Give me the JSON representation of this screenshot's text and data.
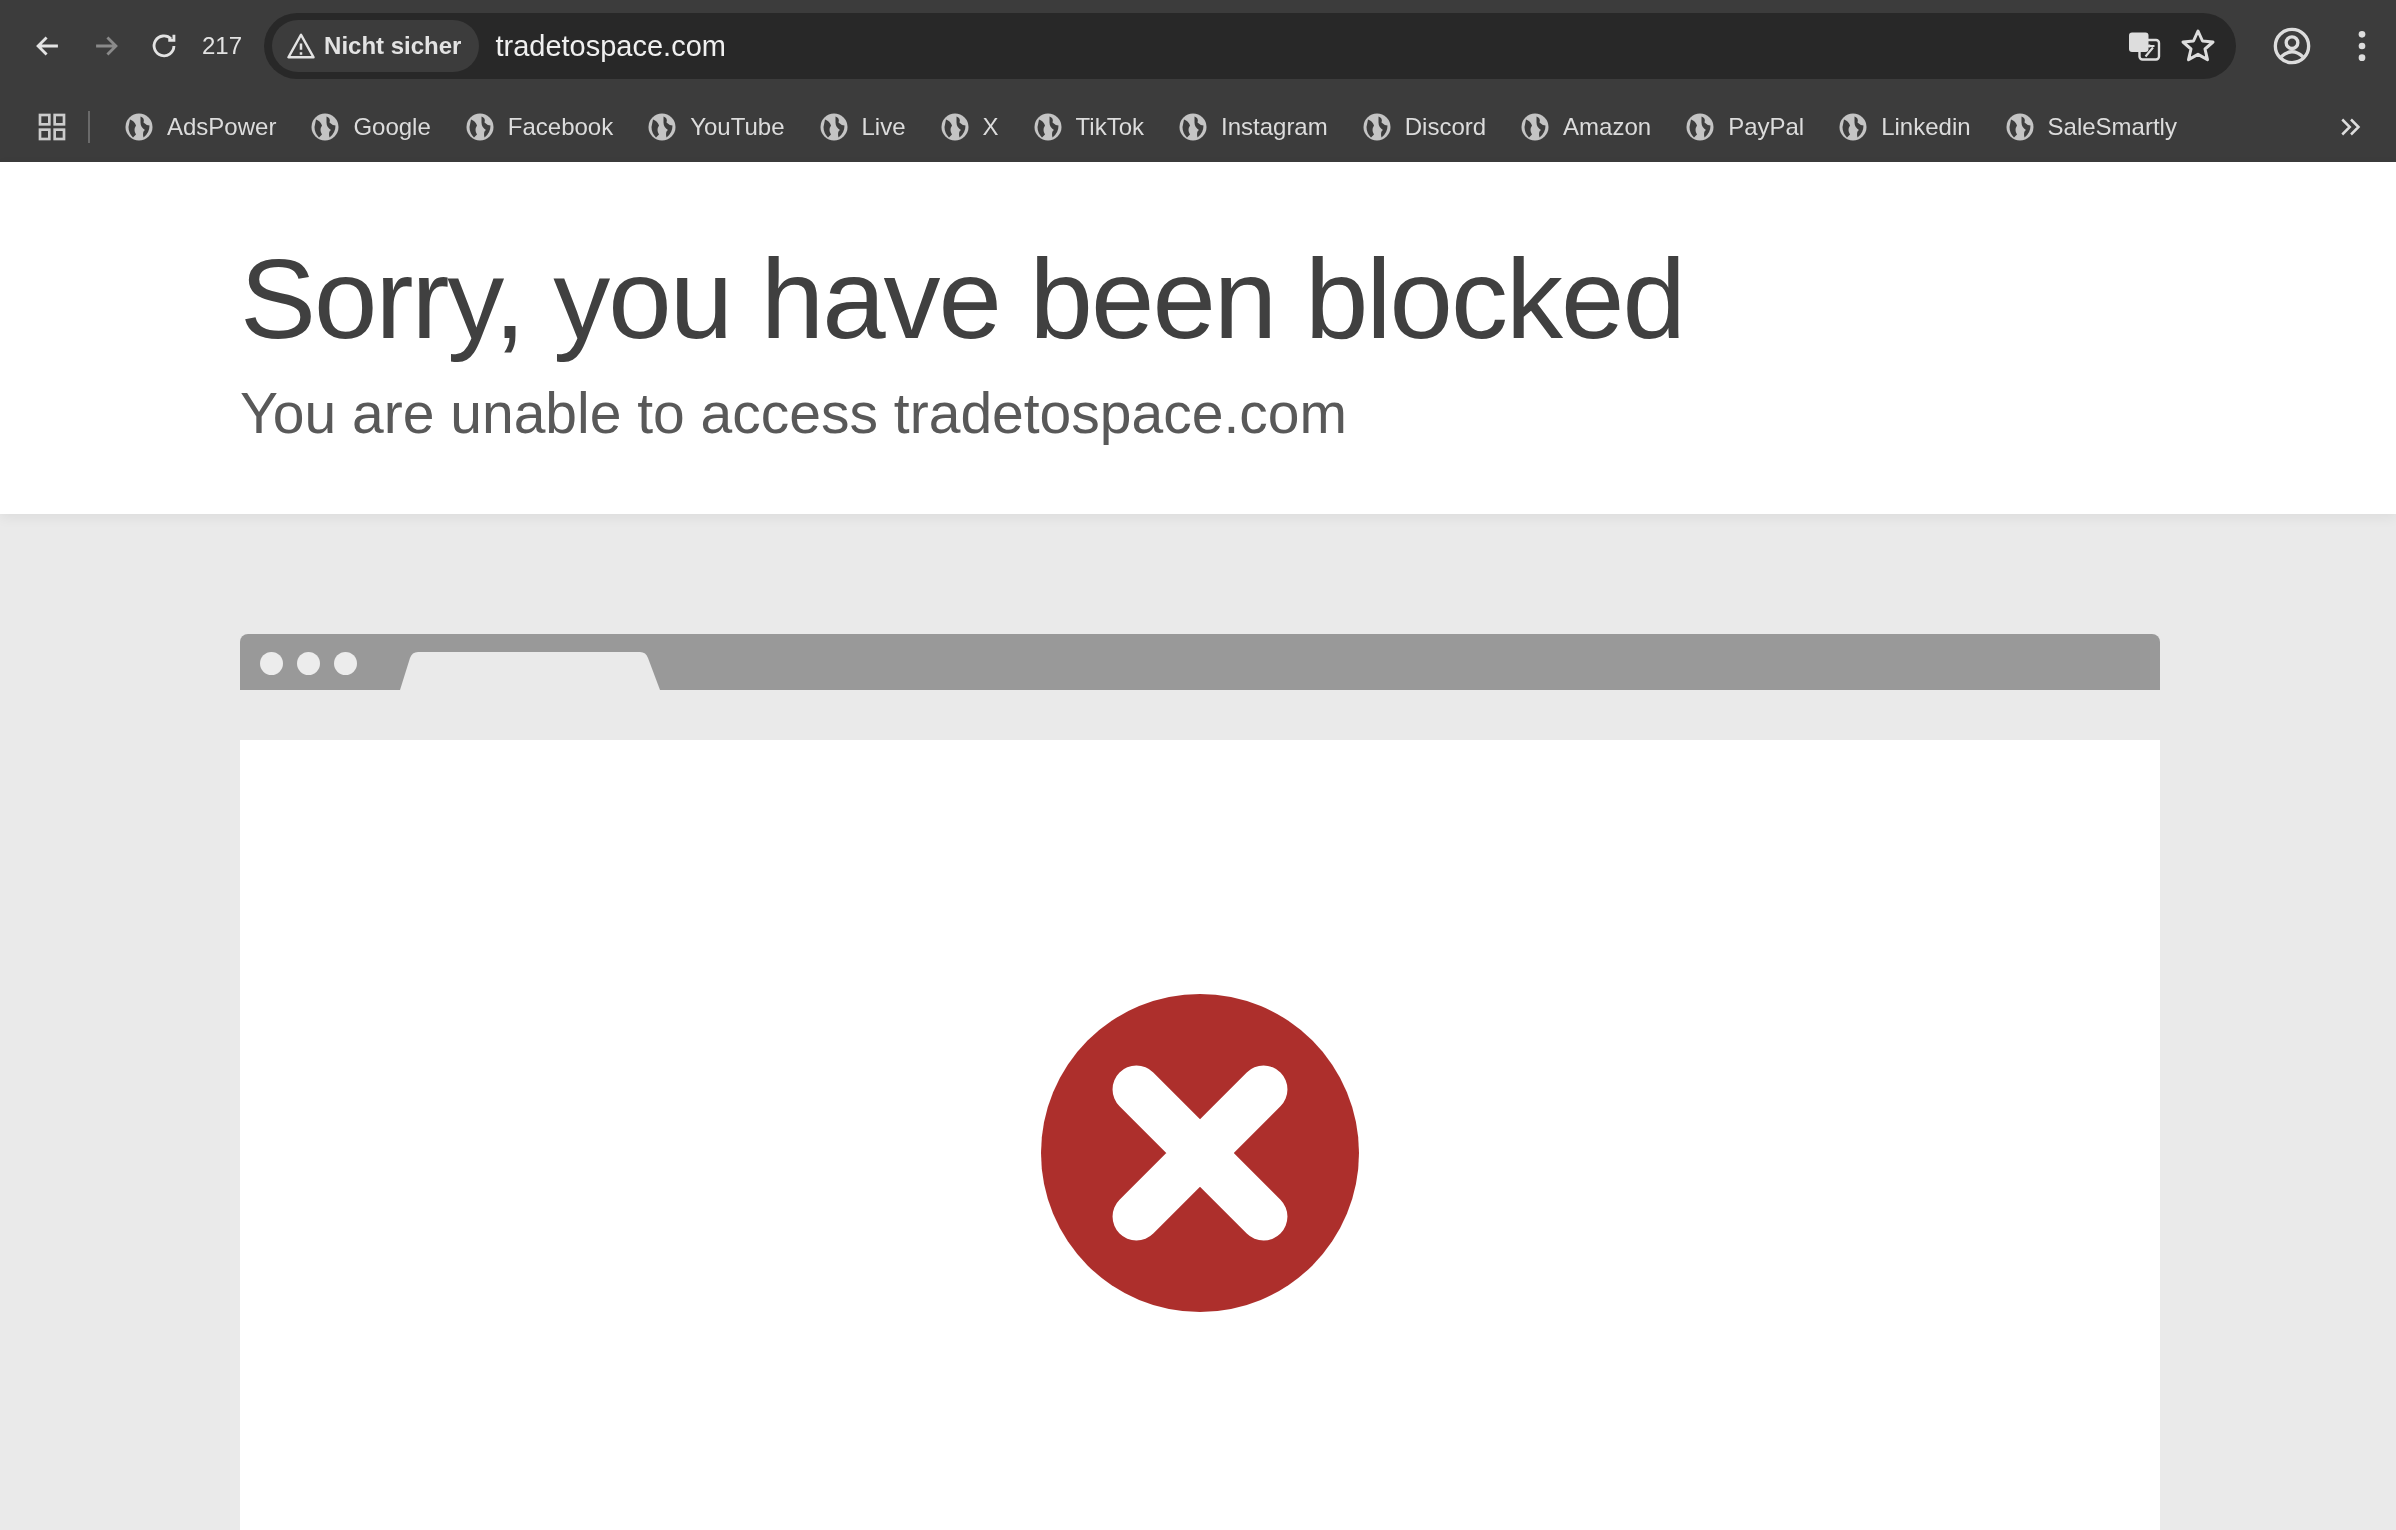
{
  "browser": {
    "nav": [
      {
        "kind": "back",
        "disabled": false
      },
      {
        "kind": "forward",
        "disabled": true
      },
      {
        "kind": "reload",
        "disabled": false
      }
    ],
    "tab_count": "217",
    "security": "Nicht sicher",
    "url": "tradetospace.com",
    "bookmarks": [
      "AdsPower",
      "Google",
      "Facebook",
      "YouTube",
      "Live",
      "X",
      "TikTok",
      "Instagram",
      "Discord",
      "Amazon",
      "PayPal",
      "Linkedin",
      "SaleSmartly"
    ]
  },
  "page": {
    "title": "Sorry, you have been blocked",
    "subtitle": "You are unable to access tradetospace.com"
  }
}
